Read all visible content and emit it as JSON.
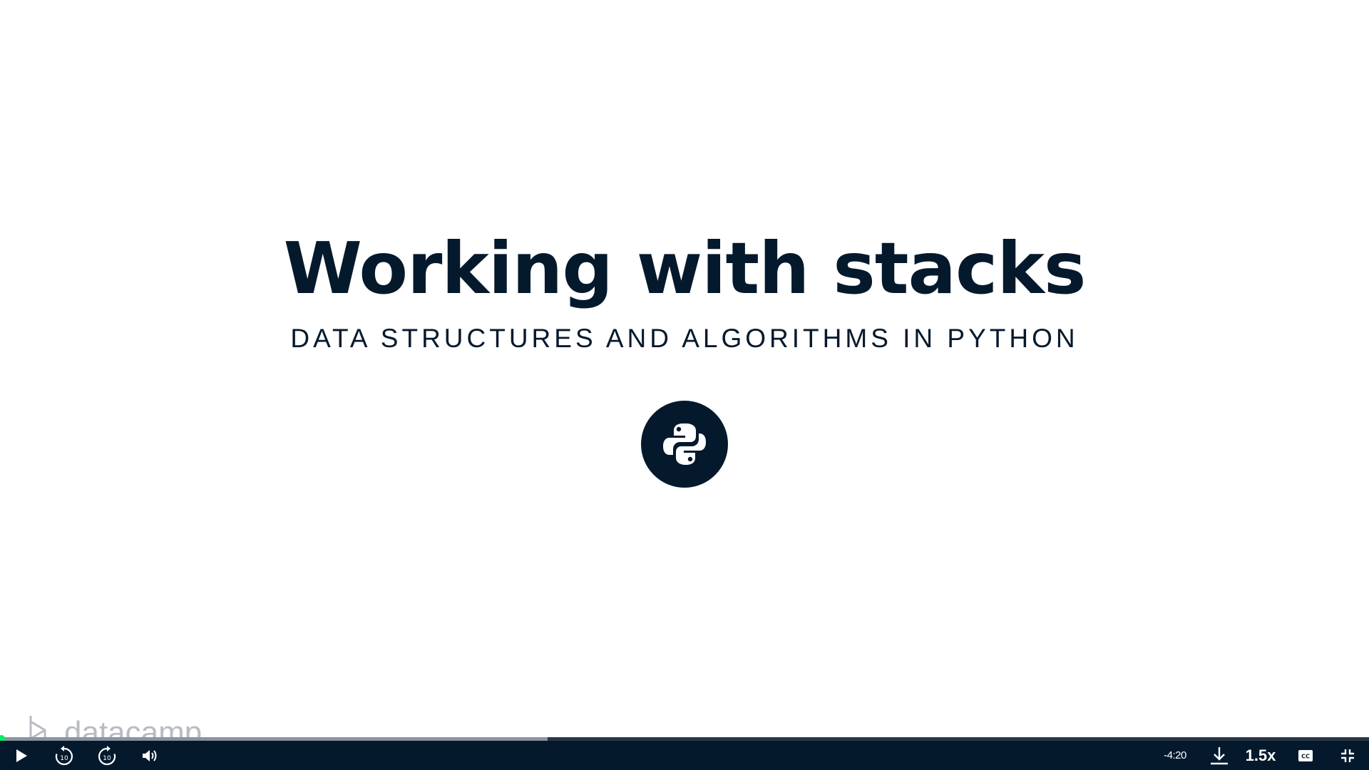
{
  "slide": {
    "title": "Working with stacks",
    "subtitle": "DATA STRUCTURES AND ALGORITHMS IN PYTHON",
    "logo_icon": "python-logo-icon",
    "watermark": "datacamp"
  },
  "player": {
    "progress_fraction": 0.4,
    "time_remaining": "-4:20",
    "playback_speed": "1.5x",
    "icons": {
      "play": "play-icon",
      "rewind": "rewind-10-icon",
      "forward": "forward-10-icon",
      "volume": "volume-icon",
      "download": "download-icon",
      "captions": "closed-captions-icon",
      "exit_fullscreen": "exit-fullscreen-icon"
    },
    "colors": {
      "bar_background": "#05192d",
      "progress_dot": "#03ef62"
    }
  }
}
